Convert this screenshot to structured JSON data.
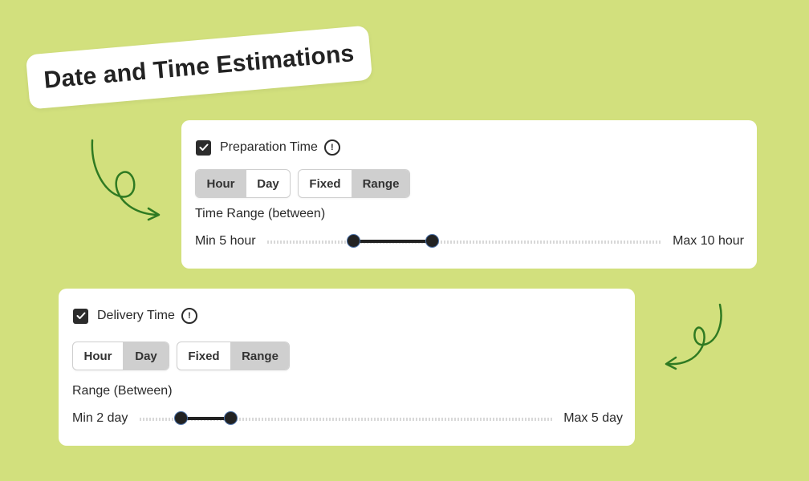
{
  "title": "Date and Time Estimations",
  "preparation": {
    "title": "Preparation Time",
    "checked": true,
    "unit_options": [
      "Hour",
      "Day"
    ],
    "unit_selected": "Hour",
    "mode_options": [
      "Fixed",
      "Range"
    ],
    "mode_selected": "Range",
    "range_label": "Time Range (between)",
    "min_label": "Min 5 hour",
    "max_label": "Max 10 hour",
    "slider_low_fraction": 0.22,
    "slider_high_fraction": 0.42
  },
  "delivery": {
    "title": "Delivery Time",
    "checked": true,
    "unit_options": [
      "Hour",
      "Day"
    ],
    "unit_selected": "Day",
    "mode_options": [
      "Fixed",
      "Range"
    ],
    "mode_selected": "Range",
    "range_label": "Range (Between)",
    "min_label": "Min 2 day",
    "max_label": "Max 5 day",
    "slider_low_fraction": 0.1,
    "slider_high_fraction": 0.22
  },
  "colors": {
    "background": "#d2e07d",
    "arrow": "#2f7a22",
    "active_segment": "#cfcfcf",
    "slider_fill": "#222222"
  },
  "icons": {
    "checkbox": "check-icon",
    "info": "info-circle-icon",
    "decoration": "curly-arrow-icon"
  }
}
